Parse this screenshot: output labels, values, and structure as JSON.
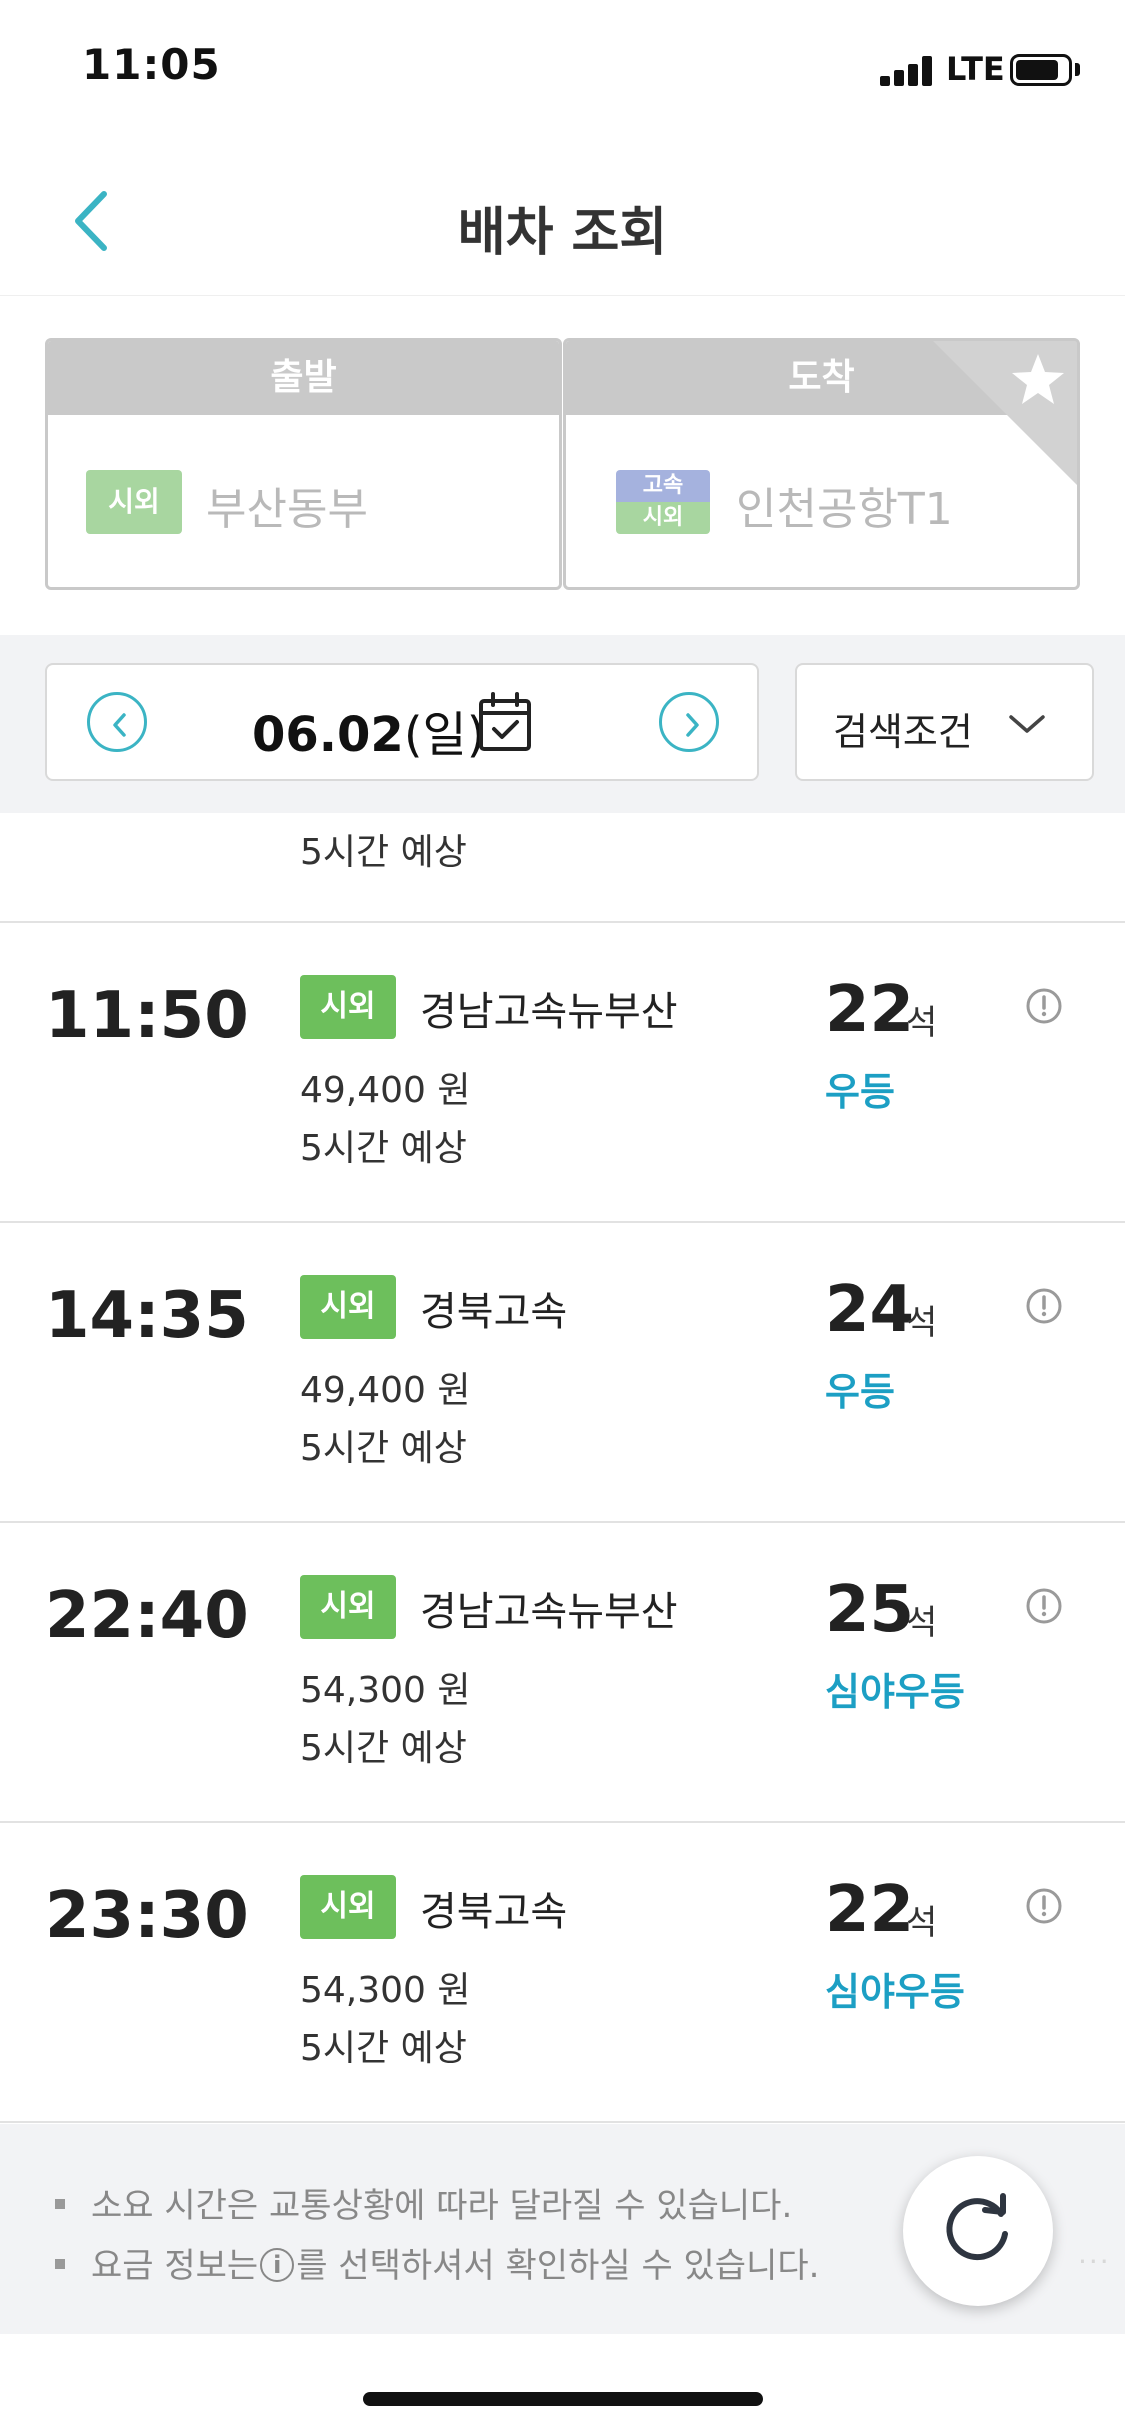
{
  "status_bar": {
    "time": "11:05",
    "network": "LTE",
    "battery": 0.85
  },
  "nav": {
    "title": "배차 조회",
    "back_icon": "chevron-left-icon"
  },
  "route": {
    "departure": {
      "header": "출발",
      "badge": "시외",
      "terminal": "부산동부"
    },
    "arrival": {
      "header": "도착",
      "badge_top": "고속",
      "badge_bottom": "시외",
      "terminal": "인천공항T1",
      "favorite_icon": "star-icon"
    }
  },
  "date_bar": {
    "date": "06.02",
    "weekday": "(일)",
    "filter_label": "검색조건",
    "prev_icon": "chevron-left-circle-icon",
    "next_icon": "chevron-right-circle-icon",
    "calendar_icon": "calendar-check-icon"
  },
  "partial_row": {
    "duration": "5시간 예상"
  },
  "schedules": [
    {
      "time": "11:50",
      "type": "시외",
      "company": "경남고속뉴부산",
      "fare": "49,400 원",
      "duration": "5시간 예상",
      "seats": "22",
      "seat_unit": "석",
      "grade": "우등"
    },
    {
      "time": "14:35",
      "type": "시외",
      "company": "경북고속",
      "fare": "49,400 원",
      "duration": "5시간 예상",
      "seats": "24",
      "seat_unit": "석",
      "grade": "우등"
    },
    {
      "time": "22:40",
      "type": "시외",
      "company": "경남고속뉴부산",
      "fare": "54,300 원",
      "duration": "5시간 예상",
      "seats": "25",
      "seat_unit": "석",
      "grade": "심야우등"
    },
    {
      "time": "23:30",
      "type": "시외",
      "company": "경북고속",
      "fare": "54,300 원",
      "duration": "5시간 예상",
      "seats": "22",
      "seat_unit": "석",
      "grade": "심야우등"
    }
  ],
  "notice": {
    "line1": "소요 시간은 교통상황에 따라 달라질 수 있습니다.",
    "line2_prefix": "요금 정보는",
    "line2_icon": "i",
    "line2_suffix": "를 선택하셔서 확인하실 수 있습니다."
  },
  "colors": {
    "accent": "#3bb4c4",
    "badge_green": "#6dbf5c",
    "grade_blue": "#1c9fc4"
  }
}
